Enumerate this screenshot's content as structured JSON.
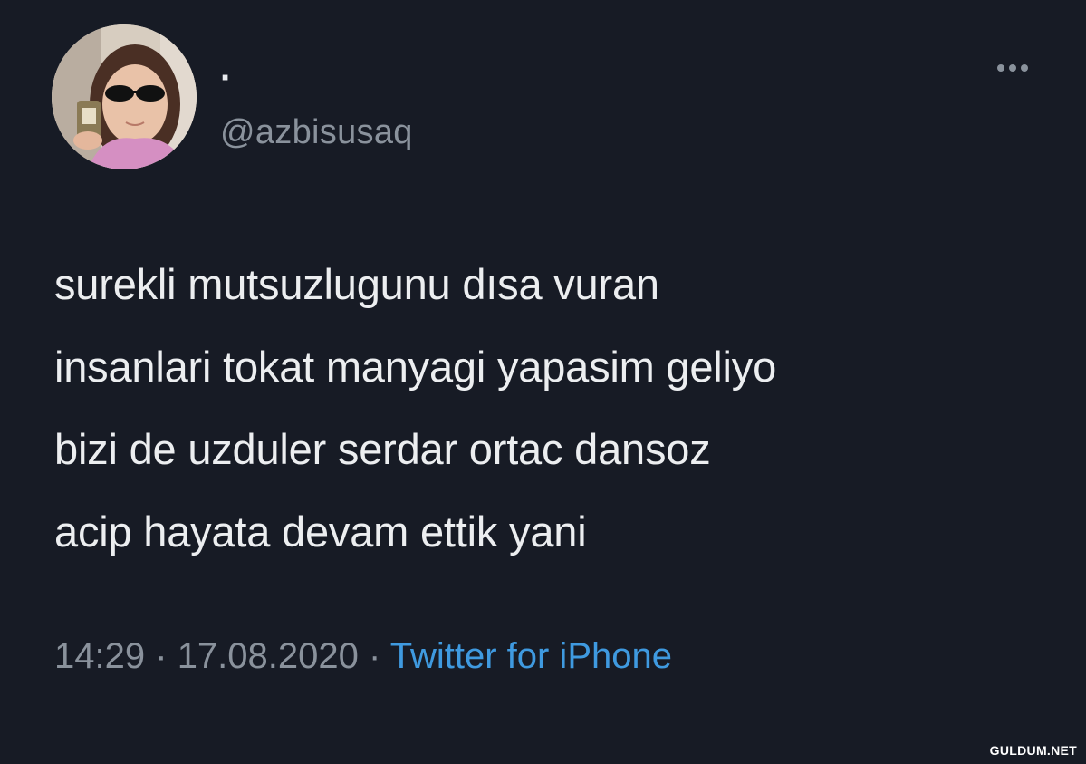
{
  "tweet": {
    "display_name": "·",
    "handle": "@azbisusaq",
    "more_icon": "more-horizontal-icon",
    "text_lines": [
      "surekli mutsuzlugunu dısa vuran",
      "insanlari tokat manyagi yapasim geliyo",
      "bizi de uzduler serdar ortac dansoz",
      "acip hayata devam ettik yani"
    ],
    "time": "14:29",
    "separator": "·",
    "date": "17.08.2020",
    "source": "Twitter for iPhone"
  },
  "watermark": "GULDUM.NET",
  "colors": {
    "background": "#171b25",
    "text": "#eceef0",
    "muted": "#8a929c",
    "link": "#3f9ae0"
  }
}
